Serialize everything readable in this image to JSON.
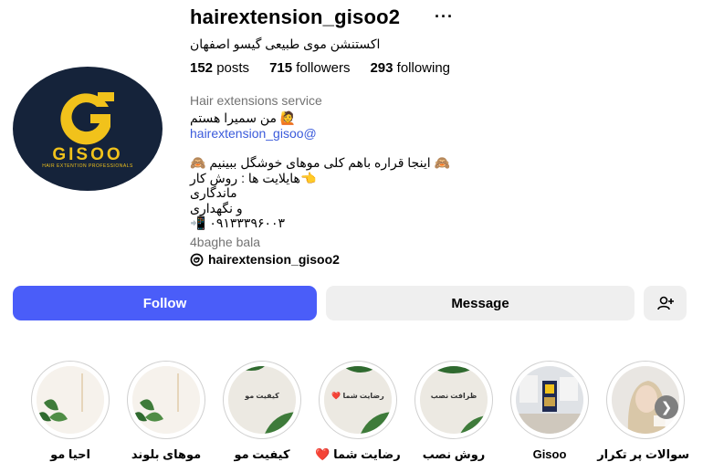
{
  "profile": {
    "username": "hairextension_gisoo2",
    "more_label": "···",
    "full_name": "اکستنشن موی طبیعی گیسو اصفهان",
    "stats": {
      "posts_count": "152",
      "posts_label": "posts",
      "followers_count": "715",
      "followers_label": "followers",
      "following_count": "293",
      "following_label": "following"
    },
    "category": "Hair extensions service",
    "bio_lines": [
      "🙋 من سمیرا هستم",
      "hairextension_gisoo@",
      "",
      "🙈 اینجا قراره باهم کلی موهای خوشگل ببینیم 🙈",
      "👈هایلایت ها : روش کار",
      "ماندگاری",
      "و نگهداری",
      "📲 ۰۹۱۳۳۳۹۶۰۰۳"
    ],
    "location": "4baghe bala",
    "threads_handle": "hairextension_gisoo2"
  },
  "logo": {
    "word": "GISOO",
    "tagline": "HAIR EXTENTION PROFESSIONALS",
    "bg_color": "#15233a",
    "accent_color": "#f1c21b"
  },
  "actions": {
    "follow_label": "Follow",
    "message_label": "Message",
    "add_user_icon": "add-user-icon"
  },
  "highlights": [
    {
      "label": "احیا مو",
      "caption": "",
      "style": "plant"
    },
    {
      "label": "موهای بلوند",
      "caption": "",
      "style": "plant"
    },
    {
      "label": "کیفیت مو",
      "caption": "کیفیت مو",
      "style": "leaf"
    },
    {
      "label": "رضایت شما ❤️",
      "caption": "رضایت شما ❤️",
      "style": "leaf"
    },
    {
      "label": "روش نصب",
      "caption": "ظرافت نصب",
      "style": "leaf"
    },
    {
      "label": "Gisoo",
      "caption": "",
      "style": "salon"
    },
    {
      "label": "سوالات پر تکرار",
      "caption": "",
      "style": "person"
    }
  ],
  "colors": {
    "follow_bg": "#4a5df9",
    "secondary_bg": "#efefef",
    "link": "#3b5bdb",
    "muted": "#737373"
  }
}
